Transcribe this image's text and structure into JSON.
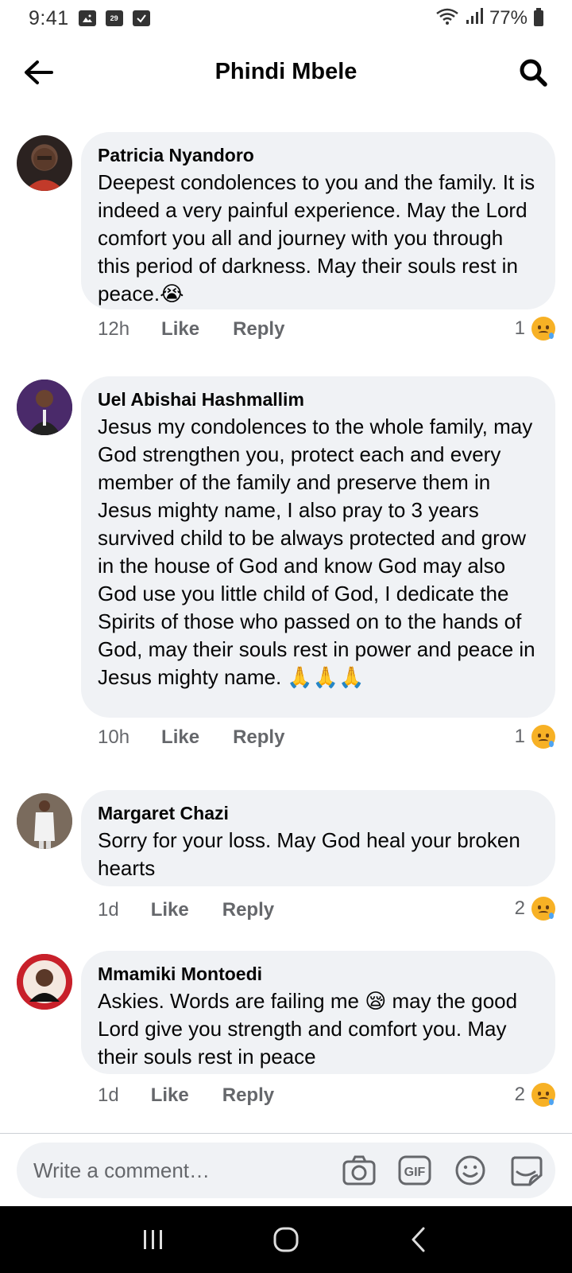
{
  "status_bar": {
    "time": "9:41",
    "calendar_day": "29",
    "battery": "77%"
  },
  "header": {
    "title": "Phindi Mbele"
  },
  "comments": [
    {
      "author": "Patricia Nyandoro",
      "text": "Deepest condolences to you and the family. It is indeed a very painful experience. May the Lord comfort you all and journey with you through this period of darkness. May their souls rest in peace.😭",
      "time": "12h",
      "like": "Like",
      "reply": "Reply",
      "reaction_count": "1",
      "reaction": "sad-icon"
    },
    {
      "author": "Uel Abishai Hashmallim",
      "text": "Jesus my condolences to the whole family, may God strengthen you, protect each and every member of the family and preserve them in Jesus mighty name, I also pray to 3 years survived child to be always protected and grow in the house of God and know God may also God use you little child of God, I dedicate the Spirits of those who passed on to the hands of God, may their souls rest in power and peace in Jesus mighty name. 🙏🙏🙏",
      "time": "10h",
      "like": "Like",
      "reply": "Reply",
      "reaction_count": "1",
      "reaction": "sad-icon"
    },
    {
      "author": "Margaret Chazi",
      "text": "Sorry for your loss. May God heal your broken hearts",
      "time": "1d",
      "like": "Like",
      "reply": "Reply",
      "reaction_count": "2",
      "reaction": "sad-icon"
    },
    {
      "author": "Mmamiki Montoedi",
      "text": "Askies. Words are failing me 😪 may the good Lord give you strength and comfort you. May their souls rest in peace",
      "time": "1d",
      "like": "Like",
      "reply": "Reply",
      "reaction_count": "2",
      "reaction": "sad-icon"
    }
  ],
  "composer": {
    "placeholder": "Write a comment…",
    "gif_label": "GIF"
  },
  "colors": {
    "bubble": "#f0f2f5",
    "meta": "#65676b",
    "text": "#050505"
  }
}
